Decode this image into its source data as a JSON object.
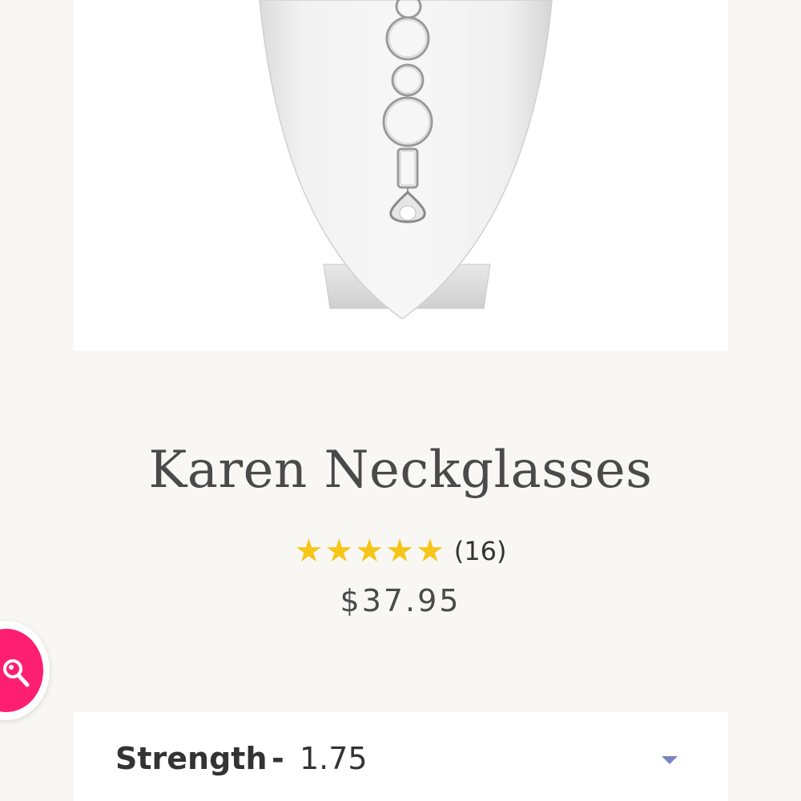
{
  "product": {
    "title": "Karen Neckglasses",
    "rating": 5,
    "rating_max": 5,
    "review_count": "(16)",
    "price": "$37.95"
  },
  "options": {
    "strength": {
      "label": "Strength",
      "separator": "-",
      "value": "1.75"
    }
  },
  "icons": {
    "search_fab": "search-icon",
    "dropdown": "chevron-down-icon",
    "star": "star-icon"
  },
  "colors": {
    "background": "#f8f7f4",
    "card": "#ffffff",
    "star": "#f5c518",
    "accent": "#ff1f72",
    "caret": "#7b84c2",
    "text": "#4a4a4a"
  }
}
